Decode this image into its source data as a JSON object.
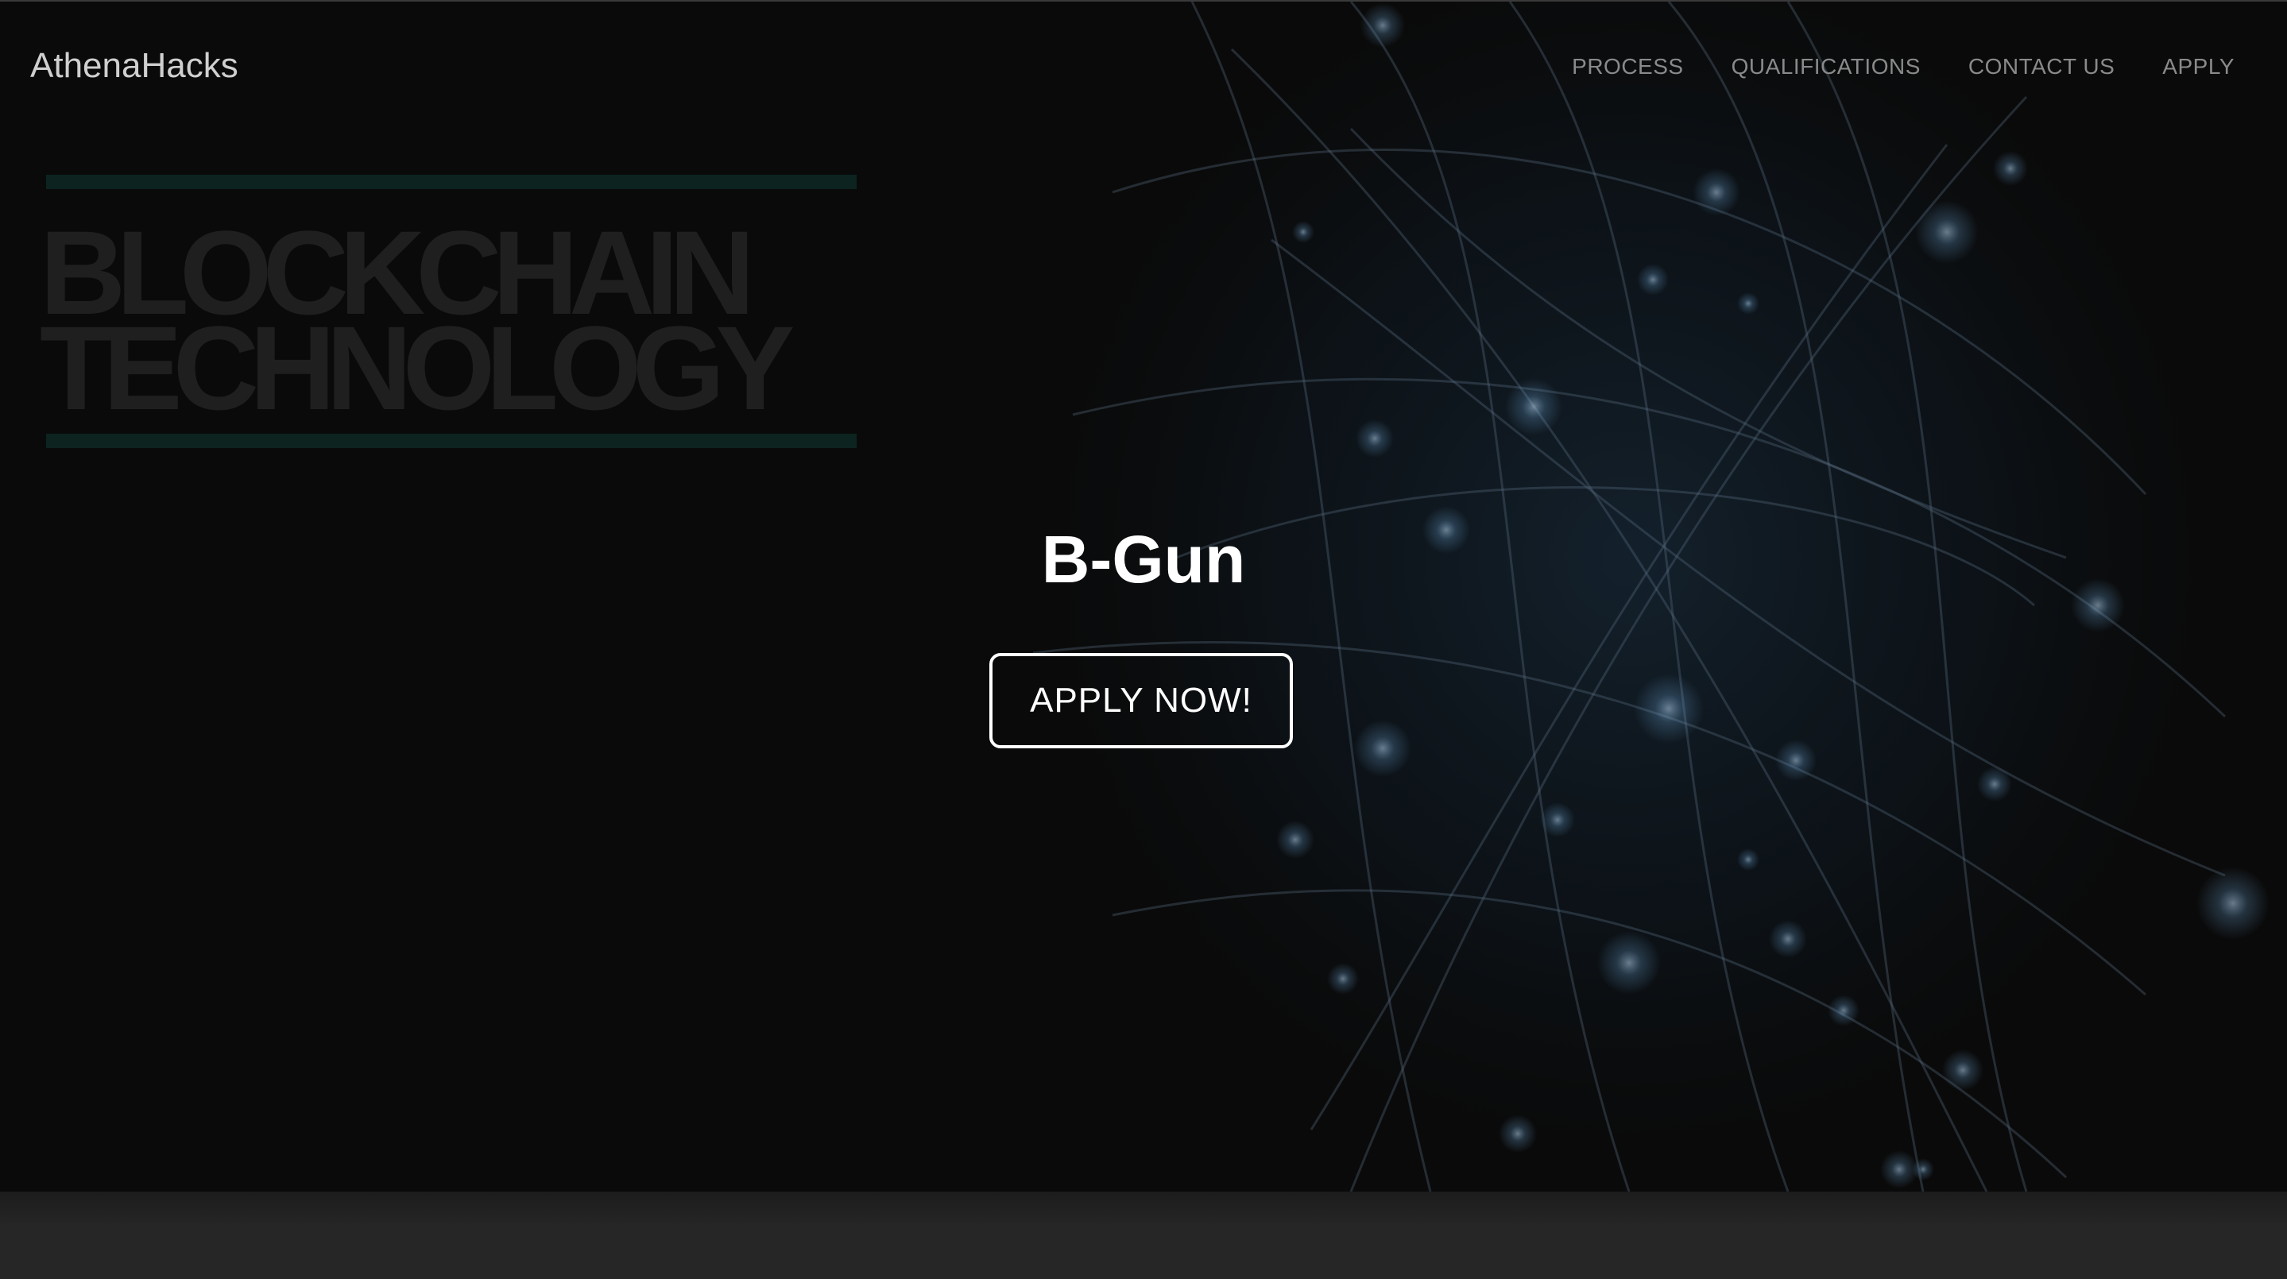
{
  "navbar": {
    "brand": "AthenaHacks",
    "links": [
      "PROCESS",
      "QUALIFICATIONS",
      "CONTACT US",
      "APPLY"
    ]
  },
  "hero": {
    "background_logo_lines": [
      "BLOCKCHAIN",
      "TECHNOLOGY"
    ],
    "title": "B-Gun",
    "cta_label": "APPLY NOW!"
  },
  "colors": {
    "background": "#0a0a0a",
    "accent_glow": "#6ea8d8",
    "text": "#ffffff",
    "nav_text": "#8a8a8a",
    "logo_rule": "#0d2320"
  }
}
